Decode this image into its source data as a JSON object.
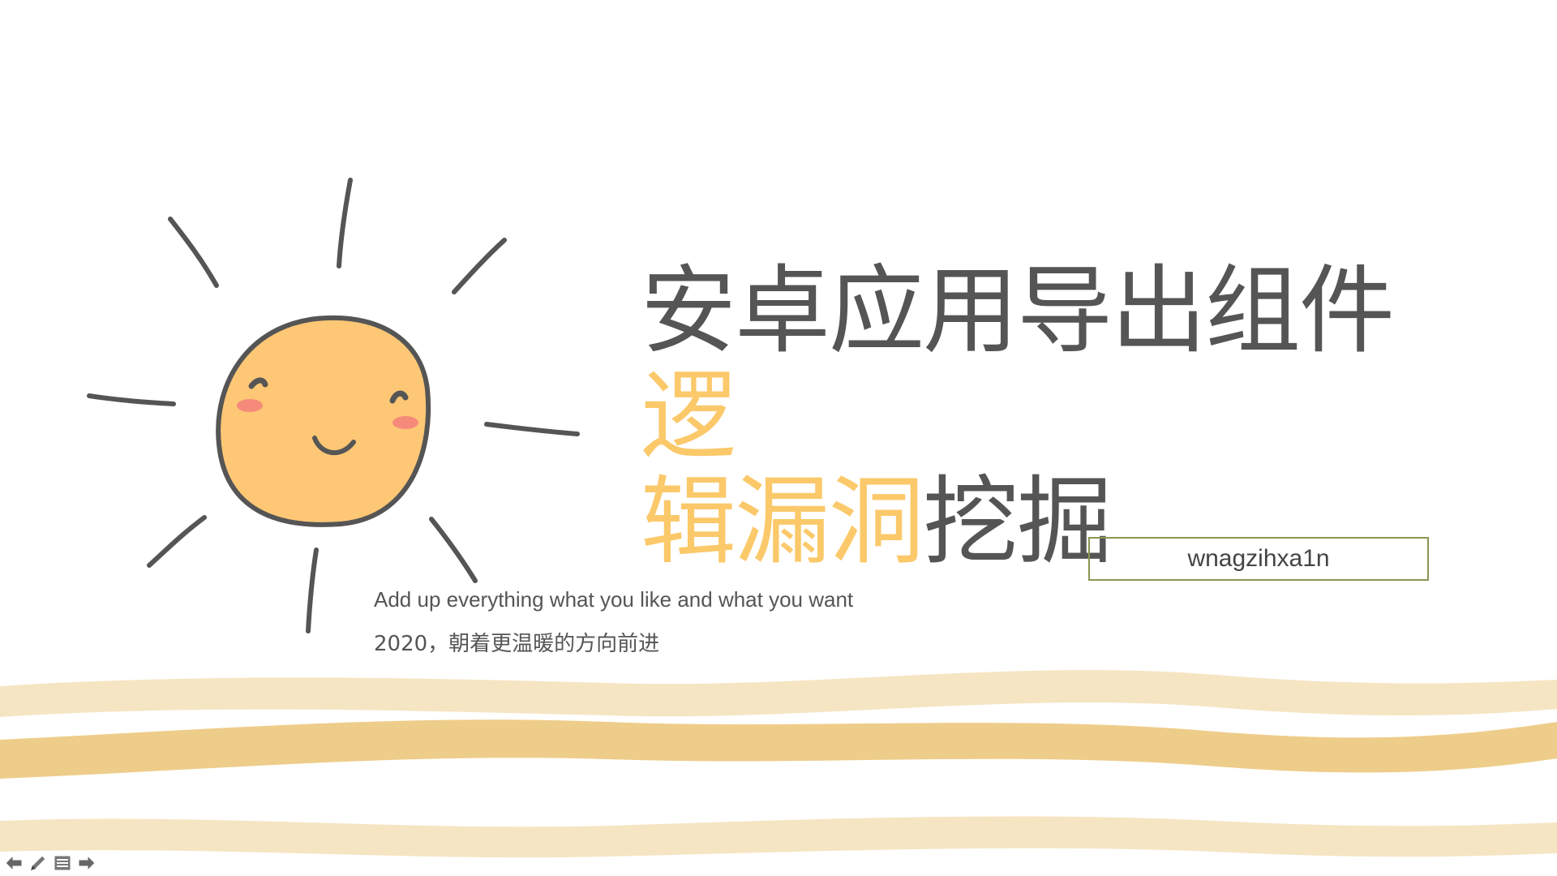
{
  "slide": {
    "title_part1": "安卓应用导出组件",
    "title_part2": "逻",
    "title_part3": "辑漏洞",
    "title_part4": "挖掘",
    "author": "wnagzihxa1n",
    "subtitle_en": "Add up everything what you like and what you want",
    "subtitle_cn": "2020，朝着更温暖的方向前进"
  },
  "colors": {
    "title_gray": "#555555",
    "title_highlight": "#fbc96a",
    "sun_fill": "#fdc775",
    "sun_outline": "#555555",
    "cheek": "#f58a7b",
    "wave_light": "#f6e5c3",
    "wave_dark": "#eecd8a",
    "author_border": "#8d9553"
  },
  "nav": {
    "prev_icon": "arrow-left-icon",
    "pen_icon": "pen-icon",
    "menu_icon": "menu-icon",
    "next_icon": "arrow-right-icon"
  }
}
